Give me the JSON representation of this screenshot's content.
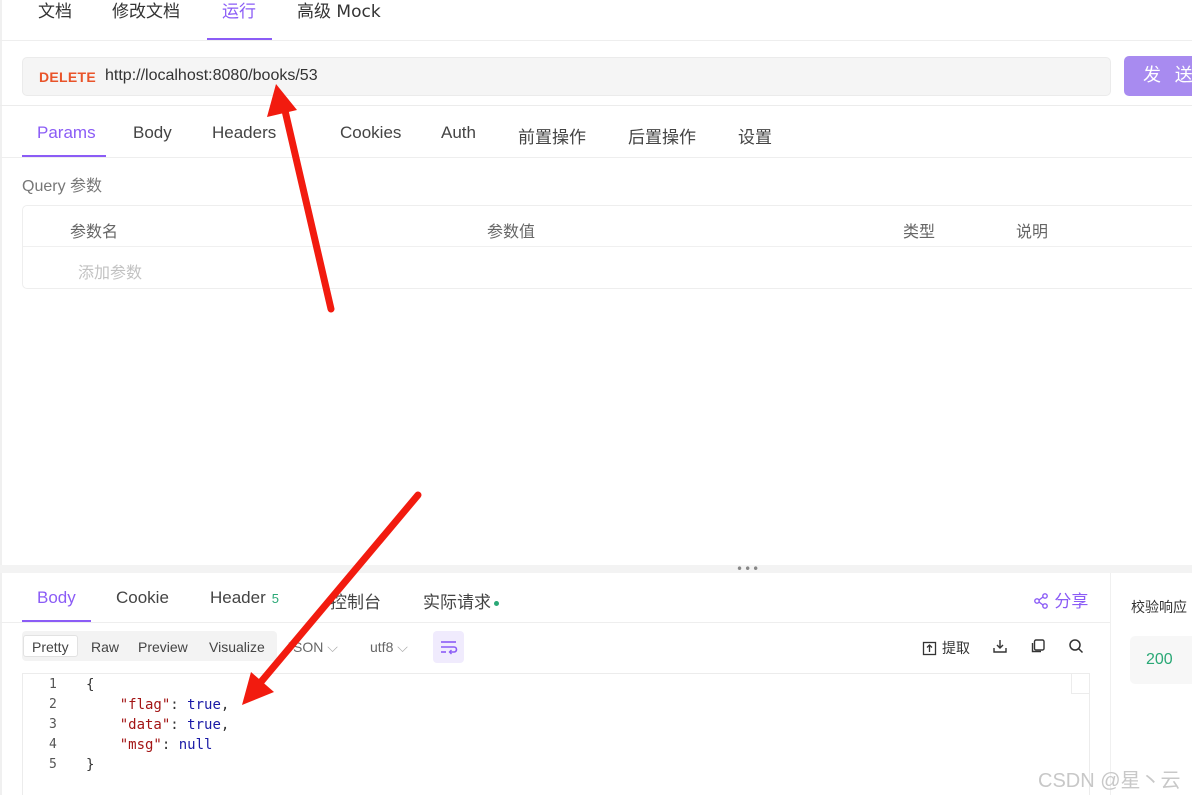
{
  "top_tabs": [
    "文档",
    "修改文档",
    "运行",
    "高级 Mock"
  ],
  "request": {
    "method": "DELETE",
    "url": "http://localhost:8080/books/53",
    "send_label": "发 送"
  },
  "request_tabs": [
    "Params",
    "Body",
    "Headers",
    "Cookies",
    "Auth",
    "前置操作",
    "后置操作",
    "设置"
  ],
  "query": {
    "section_label": "Query 参数",
    "columns": [
      "参数名",
      "参数值",
      "类型",
      "说明"
    ],
    "add_placeholder": "添加参数"
  },
  "response_tabs": {
    "body": "Body",
    "cookie": "Cookie",
    "header": "Header",
    "header_count": "5",
    "console": "控制台",
    "actual": "实际请求"
  },
  "share_label": "分享",
  "verify": {
    "label": "校验响应",
    "status": "200"
  },
  "view_modes": [
    "Pretty",
    "Raw",
    "Preview",
    "Visualize"
  ],
  "format": "JSON",
  "encoding": "utf8",
  "extract_label": "提取",
  "code": {
    "line_numbers": [
      "1",
      "2",
      "3",
      "4",
      "5"
    ],
    "brace_open": "{",
    "brace_close": "}",
    "lines": [
      {
        "key": "\"flag\"",
        "value": "true",
        "trail": ","
      },
      {
        "key": "\"data\"",
        "value": "true",
        "trail": ","
      },
      {
        "key": "\"msg\"",
        "value": "null",
        "trail": ""
      }
    ]
  },
  "watermark": "CSDN @星丶云",
  "colors": {
    "accent": "#8b5cf6",
    "method": "#e9542a",
    "success": "#2aa876",
    "annotation_arrow": "#f21b0f"
  }
}
